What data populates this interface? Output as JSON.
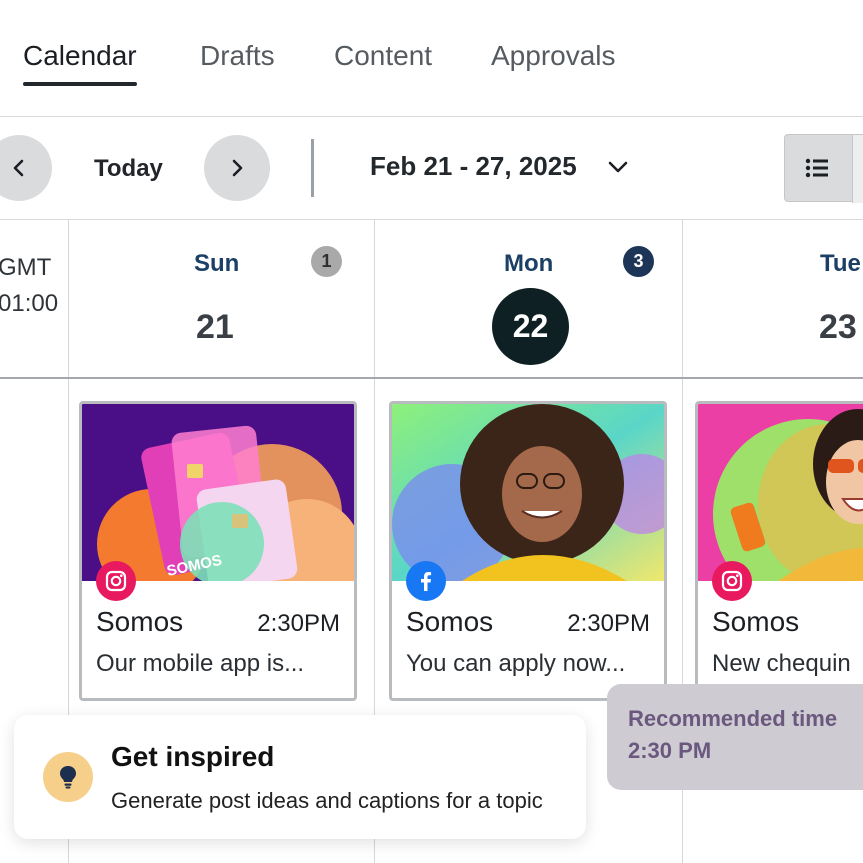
{
  "tabs": [
    {
      "label": "Calendar",
      "active": true
    },
    {
      "label": "Drafts",
      "active": false
    },
    {
      "label": "Content",
      "active": false
    },
    {
      "label": "Approvals",
      "active": false
    }
  ],
  "toolbar": {
    "prev_icon": "chevron-left-icon",
    "today_label": "Today",
    "next_icon": "chevron-right-icon",
    "date_range": "Feb 21 - 27, 2025",
    "range_icon": "chevron-down-icon",
    "view_icon": "list-view-icon"
  },
  "timezone": {
    "line1": "GMT",
    "line2": "01:00"
  },
  "days": [
    {
      "name": "Sun",
      "number": "21",
      "count": "1",
      "today": false
    },
    {
      "name": "Mon",
      "number": "22",
      "count": "3",
      "today": true
    },
    {
      "name": "Tue",
      "number": "23",
      "count": "",
      "today": false
    }
  ],
  "posts": [
    {
      "network": "instagram",
      "brand": "Somos",
      "time": "2:30PM",
      "caption": "Our mobile app is...",
      "image_text": "SOMOS"
    },
    {
      "network": "facebook",
      "brand": "Somos",
      "time": "2:30PM",
      "caption": "You can apply now..."
    },
    {
      "network": "instagram",
      "brand": "Somos",
      "time": "",
      "caption": "New chequin"
    }
  ],
  "recommended": {
    "title": "Recommended time",
    "time": "2:30 PM"
  },
  "inspire": {
    "icon": "lightbulb-icon",
    "title": "Get inspired",
    "subtitle": "Generate post ideas and captions for a topic"
  },
  "colors": {
    "accent_navy": "#1d3557",
    "today_circle": "#0f2024",
    "instagram": "#e8195f",
    "facebook": "#1877f2",
    "tooltip_bg": "#cfcbd3",
    "bulb_bg": "#f6cf8b"
  }
}
